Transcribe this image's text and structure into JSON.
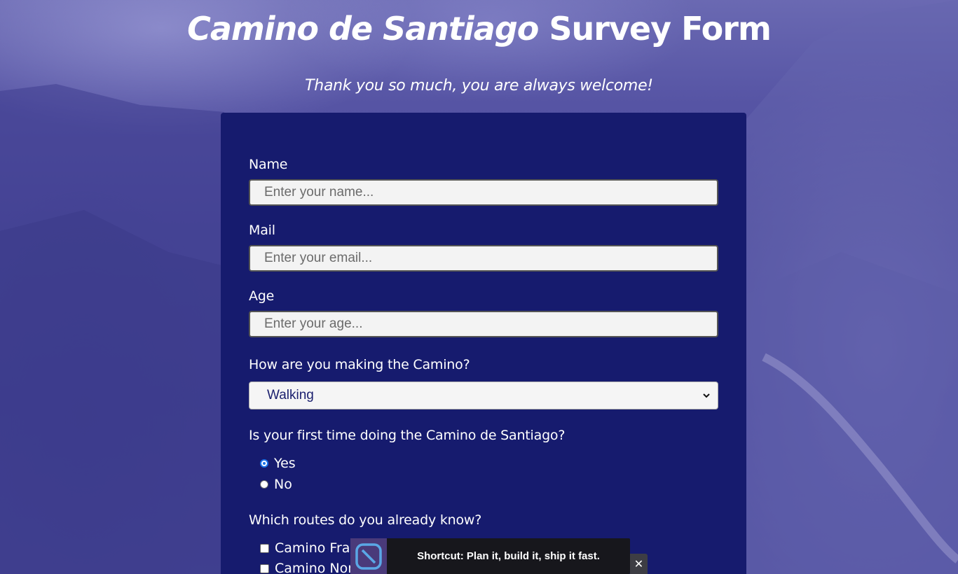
{
  "header": {
    "title_italic": "Camino de Santiago",
    "title_rest": "Survey Form",
    "subtitle": "Thank you so much, you are always welcome!"
  },
  "form": {
    "name_label": "Name",
    "name_placeholder": "Enter your name...",
    "mail_label": "Mail",
    "mail_placeholder": "Enter your email...",
    "age_label": "Age",
    "age_placeholder": "Enter your age...",
    "method_label": "How are you making the Camino?",
    "method_selected": "Walking",
    "first_time_label": "Is your first time doing the Camino de Santiago?",
    "first_time_options": [
      "Yes",
      "No"
    ],
    "first_time_selected": "Yes",
    "routes_label": "Which routes do you already know?",
    "routes_options": [
      "Camino Frar",
      "Camino Nort"
    ]
  },
  "toast": {
    "text": "Shortcut: Plan it, build it, ship it fast.",
    "close": "✕",
    "logo_icon": "shortcut-logo-icon"
  }
}
